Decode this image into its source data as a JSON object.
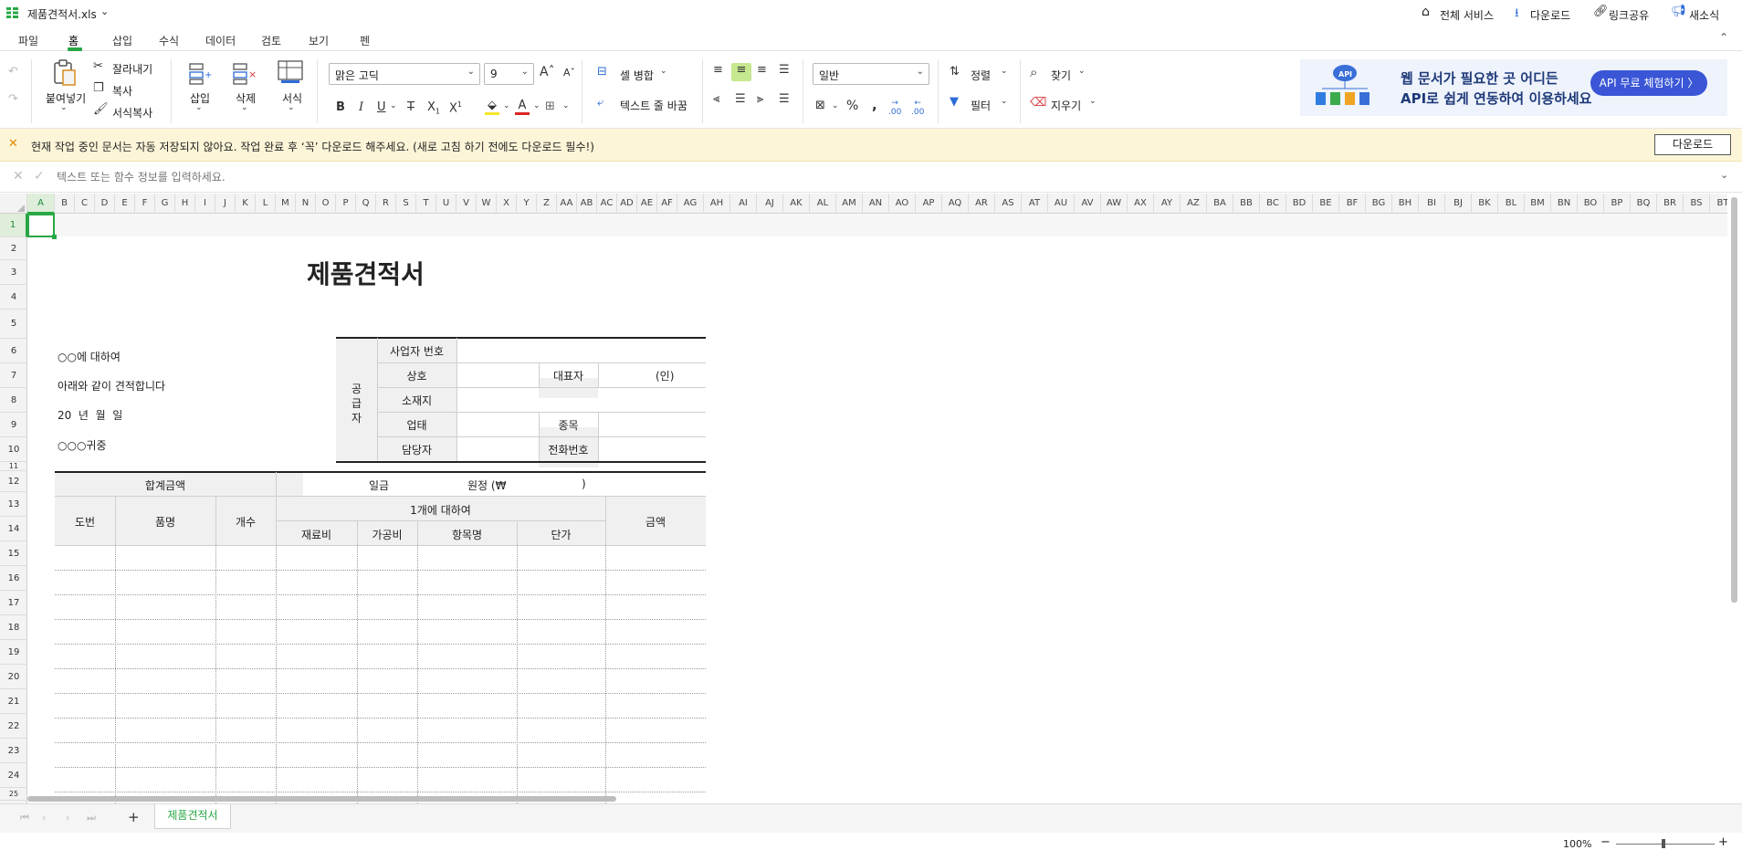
{
  "title_bar": {
    "filename": "제품견적서.xls",
    "all_services": "전체 서비스",
    "download": "다운로드",
    "share_link": "링크공유",
    "news": "새소식"
  },
  "menu": {
    "tabs": [
      "파일",
      "홈",
      "삽입",
      "수식",
      "데이터",
      "검토",
      "보기",
      "펜"
    ],
    "active": "홈"
  },
  "ribbon": {
    "paste": "붙여넣기",
    "cut": "잘라내기",
    "copy": "복사",
    "format_painter": "서식복사",
    "insert": "삽입",
    "delete": "삭제",
    "format": "서식",
    "font_name": "맑은 고딕",
    "font_size": "9",
    "merge_cells": "셀 병합",
    "wrap_text": "텍스트 줄 바꿈",
    "number_format": "일반",
    "sort": "정렬",
    "filter": "필터",
    "find": "찾기",
    "clear": "지우기"
  },
  "ad": {
    "line1": "웹 문서가 필요한 곳 어디든",
    "line2": "API로 쉽게 연동하여 이용하세요",
    "button": "API 무료 체험하기 〉",
    "icon_label": "API"
  },
  "notice": {
    "text": "현재 작업 중인 문서는 자동 저장되지 않아요. 작업 완료 후 ‘꼭’ 다운로드 해주세요. (새로 고침 하기 전에도 다운로드 필수!)",
    "button": "다운로드"
  },
  "formula_bar": {
    "placeholder": "텍스트 또는 함수 정보를 입력하세요."
  },
  "columns": [
    "A",
    "B",
    "C",
    "D",
    "E",
    "F",
    "G",
    "H",
    "I",
    "J",
    "K",
    "L",
    "M",
    "N",
    "O",
    "P",
    "Q",
    "R",
    "S",
    "T",
    "U",
    "V",
    "W",
    "X",
    "Y",
    "Z",
    "AA",
    "AB",
    "AC",
    "AD",
    "AE",
    "AF",
    "AG",
    "AH",
    "AI",
    "AJ",
    "AK",
    "AL",
    "AM",
    "AN",
    "AO",
    "AP",
    "AQ",
    "AR",
    "AS",
    "AT",
    "AU",
    "AV",
    "AW",
    "AX",
    "AY",
    "AZ",
    "BA",
    "BB",
    "BC",
    "BD",
    "BE",
    "BF",
    "BG",
    "BH",
    "BI",
    "BJ",
    "BK",
    "BL",
    "BM",
    "BN",
    "BO",
    "BP",
    "BQ",
    "BR",
    "BS",
    "BT"
  ],
  "rows": [
    "1",
    "2",
    "3",
    "4",
    "5",
    "6",
    "7",
    "8",
    "9",
    "10",
    "11",
    "12",
    "13",
    "14",
    "15",
    "16",
    "17",
    "18",
    "19",
    "20",
    "21",
    "22",
    "23",
    "24",
    "25"
  ],
  "sheet": {
    "title": "제품견적서",
    "left": {
      "about": "○○에 대하여",
      "estimate": "아래와 같이 견적합니다",
      "date": "20  년  월  일",
      "to": "○○○귀중"
    },
    "supplier": {
      "side": [
        "공",
        "급",
        "자"
      ],
      "biz_no": "사업자 번호",
      "name": "상호",
      "ceo": "대표자",
      "seal": "(인)",
      "address": "소재지",
      "business": "업태",
      "item": "종목",
      "manager": "담당자",
      "phone": "전화번호"
    },
    "total": {
      "label": "합계금액",
      "amount": "일금",
      "won": "원정 (₩",
      "close": ")"
    },
    "table_headers": {
      "no": "도번",
      "product": "품명",
      "qty": "개수",
      "per_unit": "1개에 대하여",
      "material": "재료비",
      "processing": "가공비",
      "item_name": "항목명",
      "unit_price": "단가",
      "amount": "금액"
    }
  },
  "sheet_tabs": {
    "active": "제품견적서",
    "add": "+"
  },
  "status": {
    "zoom": "100%"
  }
}
